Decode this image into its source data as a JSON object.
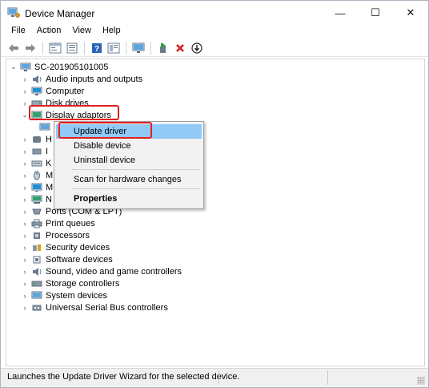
{
  "window": {
    "title": "Device Manager",
    "minimize_glyph": "—",
    "maximize_glyph": "☐",
    "close_glyph": "✕"
  },
  "menubar": {
    "items": [
      {
        "label": "File"
      },
      {
        "label": "Action"
      },
      {
        "label": "View"
      },
      {
        "label": "Help"
      }
    ]
  },
  "toolbar": {
    "icons": [
      "back-arrow-icon",
      "forward-arrow-icon",
      "properties-icon",
      "details-icon",
      "help-icon",
      "tree-view-icon",
      "scan-monitor-icon",
      "enable-device-icon",
      "uninstall-x-icon",
      "update-driver-icon"
    ]
  },
  "tree": {
    "root": {
      "label": "SC-201905101005",
      "expanded": true
    },
    "categories": [
      {
        "label": "Audio inputs and outputs",
        "icon": "speaker-icon",
        "expanded": false
      },
      {
        "label": "Computer",
        "icon": "computer-icon",
        "expanded": false
      },
      {
        "label": "Disk drives",
        "icon": "disk-drive-icon",
        "expanded": false
      },
      {
        "label": "Display adaptors",
        "icon": "display-adapter-icon",
        "expanded": true,
        "highlighted": true
      },
      {
        "label": "H",
        "icon": "hid-icon",
        "expanded": false,
        "partially_hidden": true
      },
      {
        "label": "I",
        "icon": "ide-icon",
        "expanded": false,
        "partially_hidden": true
      },
      {
        "label": "K",
        "icon": "keyboard-icon",
        "expanded": false,
        "partially_hidden": true
      },
      {
        "label": "M",
        "icon": "mouse-icon",
        "expanded": false,
        "partially_hidden": true
      },
      {
        "label": "M",
        "icon": "monitor-icon",
        "expanded": false,
        "partially_hidden": true
      },
      {
        "label": "N",
        "icon": "network-icon",
        "expanded": false,
        "partially_hidden": true
      },
      {
        "label": "Ports (COM & LPT)",
        "icon": "port-icon",
        "expanded": false
      },
      {
        "label": "Print queues",
        "icon": "printer-icon",
        "expanded": false
      },
      {
        "label": "Processors",
        "icon": "processor-icon",
        "expanded": false
      },
      {
        "label": "Security devices",
        "icon": "security-device-icon",
        "expanded": false
      },
      {
        "label": "Software devices",
        "icon": "software-device-icon",
        "expanded": false
      },
      {
        "label": "Sound, video and game controllers",
        "icon": "sound-icon",
        "expanded": false
      },
      {
        "label": "Storage controllers",
        "icon": "storage-controller-icon",
        "expanded": false
      },
      {
        "label": "System devices",
        "icon": "system-device-icon",
        "expanded": false
      },
      {
        "label": "Universal Serial Bus controllers",
        "icon": "usb-icon",
        "expanded": false
      }
    ]
  },
  "context_menu": {
    "items": [
      {
        "label": "Update driver",
        "active": true,
        "highlighted": true
      },
      {
        "label": "Disable device"
      },
      {
        "label": "Uninstall device"
      },
      {
        "label": "Scan for hardware changes"
      },
      {
        "label": "Properties",
        "bold": true
      }
    ]
  },
  "statusbar": {
    "text": "Launches the Update Driver Wizard for the selected device."
  },
  "colors": {
    "highlight_red": "#e02020",
    "menu_active": "#91c9f7",
    "monitor_blue": "#1e90d8",
    "uninstall_red": "#d81e1e",
    "enable_green": "#2e9e3e"
  }
}
